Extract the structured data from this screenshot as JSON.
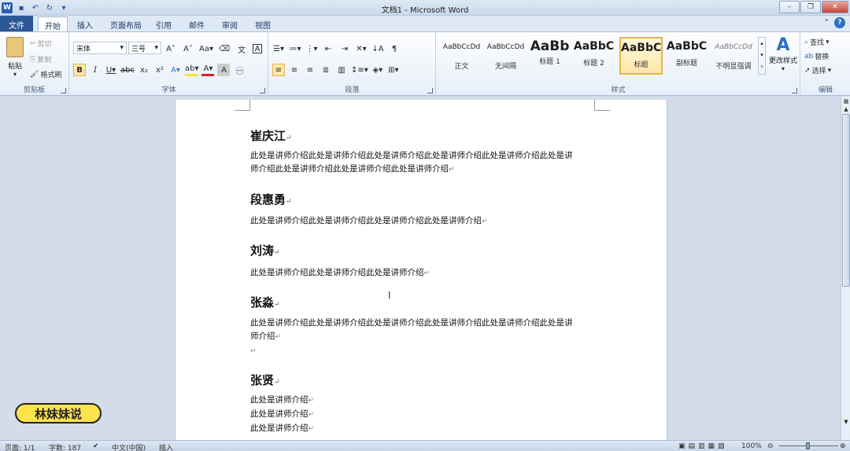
{
  "titlebar": {
    "title": "文档1 - Microsoft Word",
    "app_icon": "W"
  },
  "tabs": [
    {
      "label": "文件"
    },
    {
      "label": "开始"
    },
    {
      "label": "插入"
    },
    {
      "label": "页面布局"
    },
    {
      "label": "引用"
    },
    {
      "label": "邮件"
    },
    {
      "label": "审阅"
    },
    {
      "label": "视图"
    }
  ],
  "ribbon": {
    "clipboard": {
      "group": "剪贴板",
      "paste": "粘贴",
      "cut": "剪切",
      "copy": "复制",
      "format_painter": "格式刷"
    },
    "font": {
      "group": "字体",
      "font_name": "宋体",
      "font_size": "三号"
    },
    "paragraph": {
      "group": "段落"
    },
    "styles": {
      "group": "样式",
      "items": [
        {
          "preview": "AaBbCcDd",
          "name": "正文"
        },
        {
          "preview": "AaBbCcDd",
          "name": "无间隔"
        },
        {
          "preview": "AaBb",
          "name": "标题 1"
        },
        {
          "preview": "AaBbC",
          "name": "标题 2"
        },
        {
          "preview": "AaBbC",
          "name": "标题"
        },
        {
          "preview": "AaBbC",
          "name": "副标题"
        },
        {
          "preview": "AaBbCcDd",
          "name": "不明显强调"
        }
      ],
      "change_styles": "更改样式"
    },
    "editing": {
      "group": "编辑",
      "find": "查找",
      "replace": "替换",
      "select": "选择"
    }
  },
  "document": {
    "sections": [
      {
        "name": "崔庆江",
        "lines": [
          "此处是讲师介绍此处是讲师介绍此处是讲师介绍此处是讲师介绍此处是讲师介绍此处是讲",
          "师介绍此处是讲师介绍此处是讲师介绍此处是讲师介绍"
        ]
      },
      {
        "name": "段惠勇",
        "lines": [
          "此处是讲师介绍此处是讲师介绍此处是讲师介绍此处是讲师介绍"
        ]
      },
      {
        "name": "刘涛",
        "lines": [
          "此处是讲师介绍此处是讲师介绍此处是讲师介绍"
        ]
      },
      {
        "name": "张淼",
        "lines": [
          "此处是讲师介绍此处是讲师介绍此处是讲师介绍此处是讲师介绍此处是讲师介绍此处是讲",
          "师介绍"
        ]
      },
      {
        "name": "张贤",
        "lines": [
          "此处是讲师介绍",
          "此处是讲师介绍",
          "此处是讲师介绍"
        ]
      }
    ]
  },
  "status": {
    "page": "页面: 1/1",
    "words": "字数: 187",
    "language": "中文(中国)",
    "mode": "插入",
    "zoom": "100%"
  },
  "watermark": {
    "text": "林妹妹说"
  },
  "colors": {
    "file_tab": "#2b5797",
    "accent": "#2e6dc5",
    "selected_style": "#e7b54d"
  }
}
